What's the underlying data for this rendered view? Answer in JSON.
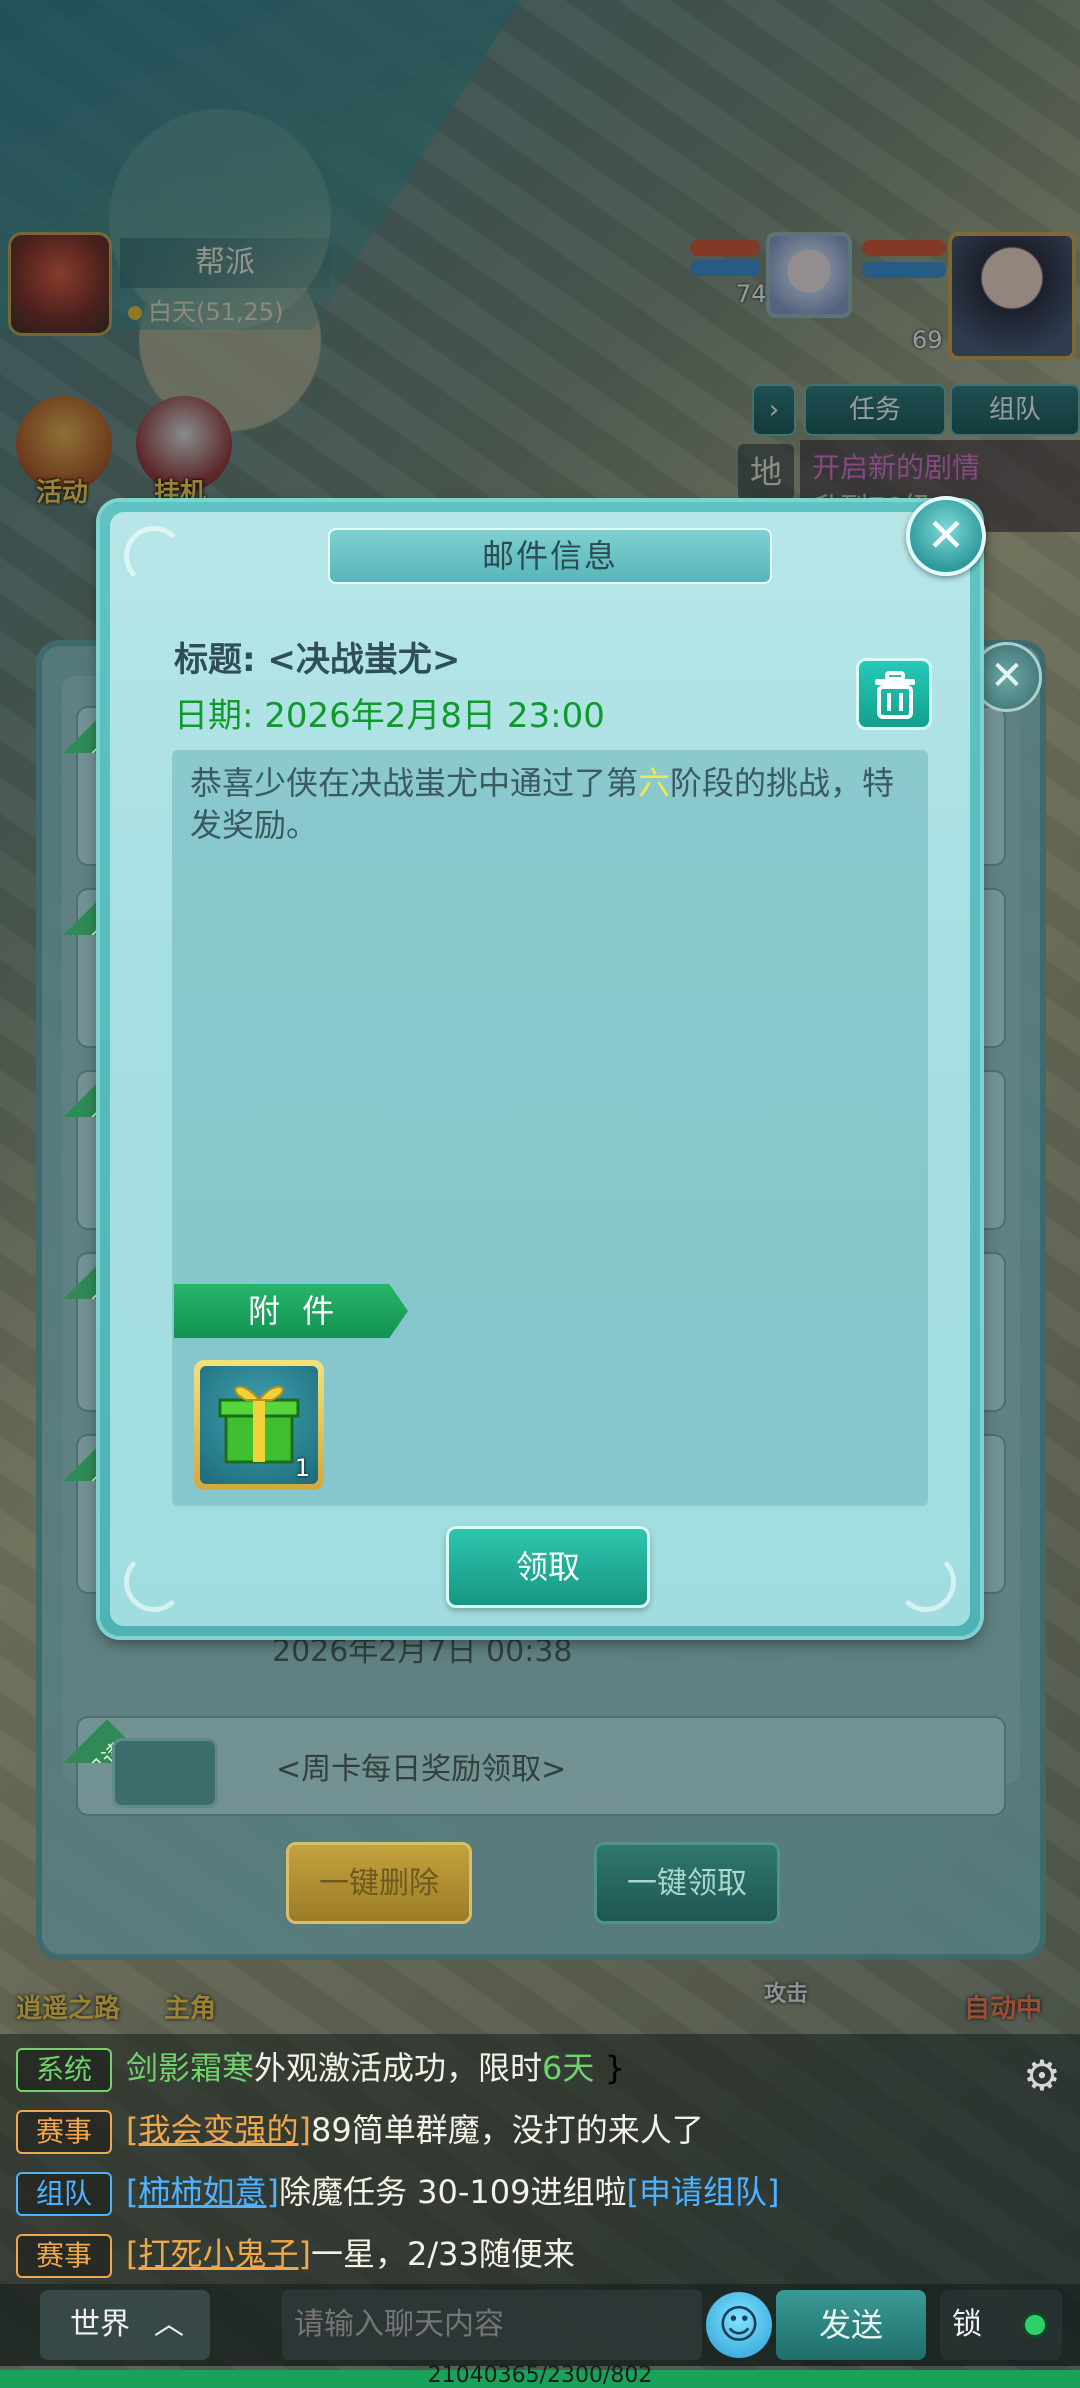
{
  "hud": {
    "guild_title": "帮派",
    "guild_time": "白天(51,25)",
    "companion_level": "74",
    "player_level": "69",
    "task_button": "任务",
    "team_button": "组队",
    "map_label": "地",
    "quest_text": "开启新的剧情",
    "quest_subtext": "升到70级",
    "activity_label": "活动",
    "idle_label": "挂机",
    "path_label": "逍遥之路",
    "hero_label": "主角",
    "attack_label": "攻击",
    "auto_label": "自动中"
  },
  "mail_list": {
    "rows": [
      {
        "badge": "已读",
        "title": "",
        "date": ""
      },
      {
        "badge": "已读",
        "title": "",
        "date": ""
      },
      {
        "badge": "已读",
        "title": "",
        "date": ""
      },
      {
        "badge": "已读",
        "title": "",
        "date": ""
      },
      {
        "badge": "已读",
        "title": "",
        "date": "2026年2月7日 00:38"
      },
      {
        "badge": "已读",
        "title": "<周卡每日奖励领取>",
        "date": ""
      }
    ],
    "delete_all": "一键删除",
    "claim_all": "一键领取"
  },
  "dialog": {
    "header": "邮件信息",
    "subject": "标题: <决战蚩尤>",
    "date": "日期: 2026年2月8日 23:00",
    "body_before": "恭喜少侠在决战蚩尤中通过了第",
    "body_highlight": "六",
    "body_after": "阶段的挑战，特发奖励。",
    "attachment_label": "附 件",
    "attachment_item": {
      "icon": "gift-box-icon",
      "count": "1"
    },
    "claim_button": "领取"
  },
  "chat": {
    "lines": [
      {
        "tag": "系统",
        "parts": [
          "剑影霜寒",
          "外观激活成功，限时",
          "6天"
        ]
      },
      {
        "tag": "赛事",
        "parts": [
          "[我会变强的]",
          "89简单群魔，没打的来人了"
        ]
      },
      {
        "tag": "组队",
        "parts": [
          "[柿柿如意]",
          "除魔任务 30-109进组啦",
          "[申请组队]"
        ]
      },
      {
        "tag": "赛事",
        "parts": [
          "[打死小鬼子]",
          "一星，2/33随便来"
        ]
      }
    ],
    "channel": "世界",
    "input_placeholder": "请输入聊天内容",
    "send": "发送",
    "lock": "锁",
    "exp_text": "21040365/2300/802"
  },
  "colors": {
    "dialog_teal": "#5fc3c4",
    "date_green": "#0f9a2c",
    "highlight_yellow": "#f3e84a",
    "attach_green": "#27b56a"
  }
}
